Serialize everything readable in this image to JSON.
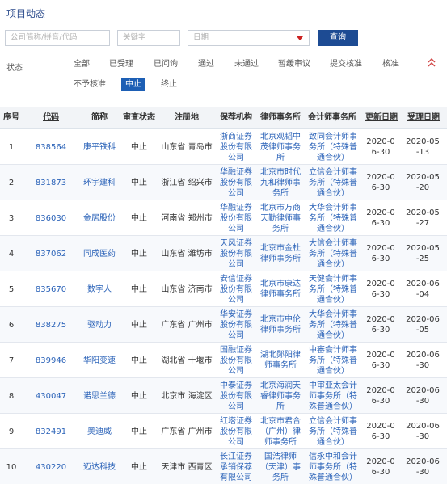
{
  "page_title": "项目动态",
  "filters": {
    "code_placeholder": "公司简称/拼音/代码",
    "keyword_placeholder": "关键字",
    "date_placeholder": "日期",
    "query_button": "查询"
  },
  "status": {
    "label": "状态",
    "options": [
      "全部",
      "已受理",
      "已问询",
      "通过",
      "未通过",
      "暂缓审议",
      "提交核准",
      "核准",
      "不予核准",
      "中止",
      "终止"
    ],
    "selected": "中止"
  },
  "colors": {
    "accent": "#1d4b93",
    "link": "#2a62b8",
    "caret": "#cc2222"
  },
  "table": {
    "headers": {
      "seq": "序号",
      "code": "代码",
      "name": "简称",
      "review_status": "审查状态",
      "location": "注册地",
      "sponsor": "保荐机构",
      "law_firm": "律师事务所",
      "accounting_firm": "会计师事务所",
      "update_date": "更新日期",
      "accept_date": "受理日期"
    },
    "rows": [
      {
        "seq": "1",
        "code": "838564",
        "name": "康平铁科",
        "status": "中止",
        "location": "山东省 青岛市",
        "sponsor": "浙商证券股份有限公司",
        "law": "北京观韬中茂律师事务所",
        "acct": "致同会计师事务所（特殊普通合伙）",
        "update": "2020-06-30",
        "accept": "2020-05-13"
      },
      {
        "seq": "2",
        "code": "831873",
        "name": "环宇建科",
        "status": "中止",
        "location": "浙江省 绍兴市",
        "sponsor": "华融证券股份有限公司",
        "law": "北京市时代九和律师事务所",
        "acct": "立信会计师事务所（特殊普通合伙）",
        "update": "2020-06-30",
        "accept": "2020-05-20"
      },
      {
        "seq": "3",
        "code": "836030",
        "name": "金居股份",
        "status": "中止",
        "location": "河南省 郑州市",
        "sponsor": "华融证券股份有限公司",
        "law": "北京市万商天勤律师事务所",
        "acct": "大华会计师事务所（特殊普通合伙）",
        "update": "2020-06-30",
        "accept": "2020-05-27"
      },
      {
        "seq": "4",
        "code": "837062",
        "name": "同成医药",
        "status": "中止",
        "location": "山东省 潍坊市",
        "sponsor": "天风证券股份有限公司",
        "law": "北京市金杜律师事务所",
        "acct": "大信会计师事务所（特殊普通合伙）",
        "update": "2020-06-30",
        "accept": "2020-05-25"
      },
      {
        "seq": "5",
        "code": "835670",
        "name": "数字人",
        "status": "中止",
        "location": "山东省 济南市",
        "sponsor": "安信证券股份有限公司",
        "law": "北京市康达律师事务所",
        "acct": "天健会计师事务所（特殊普通合伙）",
        "update": "2020-06-30",
        "accept": "2020-06-04"
      },
      {
        "seq": "6",
        "code": "838275",
        "name": "驱动力",
        "status": "中止",
        "location": "广东省 广州市",
        "sponsor": "华安证券股份有限公司",
        "law": "北京市中伦律师事务所",
        "acct": "大华会计师事务所（特殊普通合伙）",
        "update": "2020-06-30",
        "accept": "2020-06-05"
      },
      {
        "seq": "7",
        "code": "839946",
        "name": "华阳变速",
        "status": "中止",
        "location": "湖北省 十堰市",
        "sponsor": "国融证券股份有限公司",
        "law": "湖北郧阳律师事务所",
        "acct": "中審会计师事务所（特殊普通合伙）",
        "update": "2020-06-30",
        "accept": "2020-06-30"
      },
      {
        "seq": "8",
        "code": "430047",
        "name": "诺思兰德",
        "status": "中止",
        "location": "北京市 海淀区",
        "sponsor": "中泰证券股份有限公司",
        "law": "北京海润天睿律师事务所",
        "acct": "中审亚太会计师事务所（特殊普通合伙）",
        "update": "2020-06-30",
        "accept": "2020-06-30"
      },
      {
        "seq": "9",
        "code": "832491",
        "name": "奥迪威",
        "status": "中止",
        "location": "广东省 广州市",
        "sponsor": "红塔证券股份有限公司",
        "law": "北京市君合（广州）律师事务所",
        "acct": "立信会计师事务所（特殊普通合伙）",
        "update": "2020-06-30",
        "accept": "2020-06-30"
      },
      {
        "seq": "10",
        "code": "430220",
        "name": "迈达科技",
        "status": "中止",
        "location": "天津市 西青区",
        "sponsor": "长江证券承销保荐有限公司",
        "law": "国浩律师（天津）事务所",
        "acct": "信永中和会计师事务所（特殊普通合伙）",
        "update": "2020-06-30",
        "accept": "2020-06-30"
      }
    ]
  }
}
